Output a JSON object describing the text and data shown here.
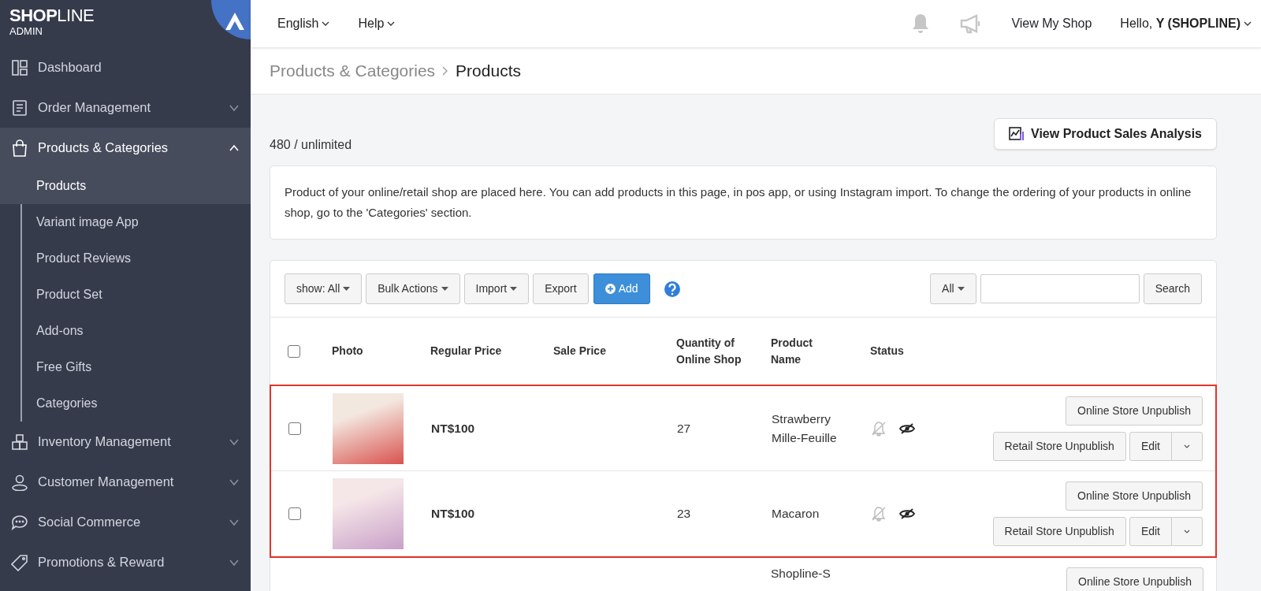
{
  "sidebar": {
    "logo": {
      "brand": "**SHOP**LINE",
      "sub": "ADMIN"
    },
    "items": [
      {
        "label": "Dashboard",
        "selected": false
      },
      {
        "label": "Order Management",
        "expanded": false,
        "selected": false
      },
      {
        "label": "Products & Categories",
        "expanded": true,
        "selected": true,
        "children": [
          {
            "label": "Products",
            "selected": true
          },
          {
            "label": "Variant image App",
            "selected": false
          },
          {
            "label": "Product Reviews",
            "selected": false
          },
          {
            "label": "Product Set",
            "selected": false
          },
          {
            "label": "Add-ons",
            "selected": false
          },
          {
            "label": "Free Gifts",
            "selected": false
          },
          {
            "label": "Categories",
            "selected": false
          }
        ]
      },
      {
        "label": "Inventory Management",
        "expanded": false,
        "selected": false
      },
      {
        "label": "Customer Management",
        "expanded": false,
        "selected": false
      },
      {
        "label": "Social Commerce",
        "expanded": false,
        "selected": false
      },
      {
        "label": "Promotions & Reward",
        "expanded": false,
        "selected": false
      }
    ]
  },
  "topbar": {
    "menus": [
      "English",
      "Help"
    ],
    "view_shop": "View My Shop",
    "greeting": "Hello, **Y (SHOPLINE)**"
  },
  "breadcrumb": [
    "Products & Categories",
    "Products"
  ],
  "count": "480 / unlimited",
  "analysis_button": "View Product Sales Analysis",
  "notice": "Product of your online/retail shop are placed here. You can add products in this page, in pos app, or using Instagram import. To change the ordering of your products in online shop, go to the 'Categories' section.",
  "toolbar": {
    "buttons": [
      {
        "label": "show: All",
        "kind": "dropdown"
      },
      {
        "label": "Bulk Actions",
        "kind": "dropdown"
      },
      {
        "label": "Import",
        "kind": "dropdown"
      },
      {
        "label": "Export",
        "kind": "plain"
      },
      {
        "label": "Add",
        "kind": "primary"
      }
    ],
    "filter": "All",
    "search_button": "Search"
  },
  "table": {
    "select_all": false,
    "columns": [
      "Photo",
      "Regular Price",
      "Sale Price",
      "Quantity of Online Shop",
      "Product Name",
      "Status"
    ],
    "rows": [
      {
        "checked": false,
        "highlighted": true,
        "regular_price": "NT$100",
        "quantity": "27",
        "name": "Strawberry Mille-Feuille",
        "actions": [
          "Online Store Unpublish",
          "Retail Store Unpublish",
          "Edit"
        ]
      },
      {
        "checked": false,
        "highlighted": true,
        "regular_price": "NT$100",
        "quantity": "23",
        "name": "Macaron",
        "actions": [
          "Online Store Unpublish",
          "Retail Store Unpublish",
          "Edit"
        ]
      },
      {
        "highlighted": false,
        "name": "Shopline-S",
        "actions": [
          "Online Store Unpublish"
        ]
      }
    ]
  }
}
